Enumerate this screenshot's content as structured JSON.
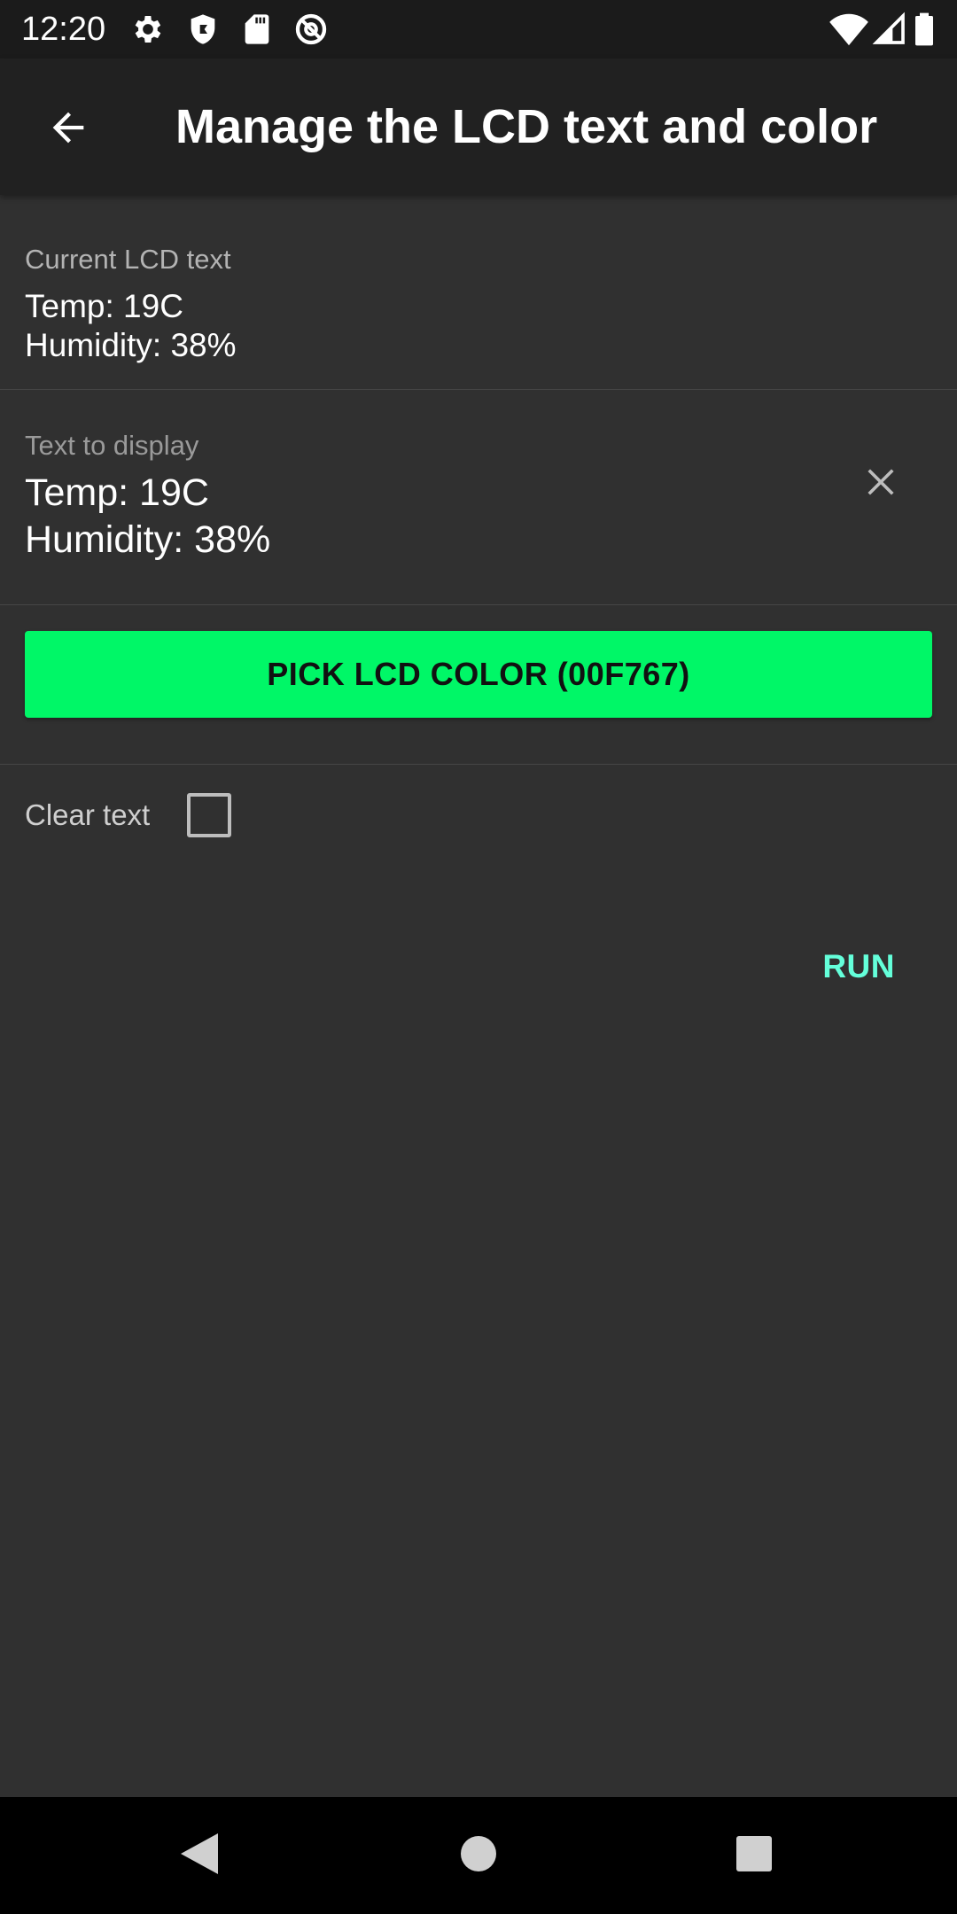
{
  "status_bar": {
    "time": "12:20",
    "left_icons": [
      "gear-icon",
      "shield-icon",
      "sd-card-icon",
      "at-sign-icon"
    ],
    "right_icons": [
      "wifi-icon",
      "cell-signal-icon",
      "battery-icon"
    ]
  },
  "app_bar": {
    "back_icon": "arrow-left-icon",
    "title": "Manage the LCD text and color"
  },
  "current_lcd": {
    "label": "Current LCD text",
    "line1": "Temp: 19C",
    "line2": "Humidity: 38%"
  },
  "text_input": {
    "hint": "Text to display",
    "line1": "Temp: 19C",
    "line2": "Humidity: 38%",
    "clear_icon": "close-icon"
  },
  "color_button": {
    "label": "PICK LCD COLOR (00F767)",
    "color": "#00F767"
  },
  "clear_option": {
    "label": "Clear text",
    "checked": false
  },
  "run_button": {
    "label": "RUN",
    "color": "#64FFDA"
  },
  "nav_bar": {
    "icons": [
      "back-triangle-icon",
      "home-circle-icon",
      "recents-square-icon"
    ]
  }
}
